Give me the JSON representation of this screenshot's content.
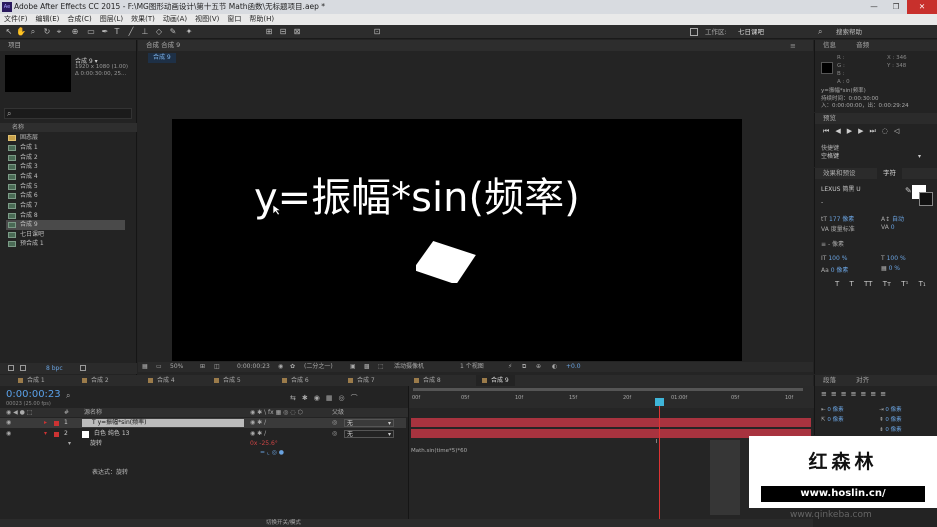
{
  "app": {
    "title": "Adobe After Effects CC 2015 - F:\\MG图形动画设计\\第十五节 Math函数\\无标题项目.aep *",
    "win_min": "—",
    "win_max": "❐",
    "win_close": "✕"
  },
  "menu": [
    "文件(F)",
    "编辑(E)",
    "合成(C)",
    "图层(L)",
    "效果(T)",
    "动画(A)",
    "视图(V)",
    "窗口",
    "帮助(H)"
  ],
  "toolbar": {
    "workspace_label": "工作区:",
    "workspace_value": "七日课吧",
    "search_help": "搜索帮助"
  },
  "project": {
    "panel_title": "项目",
    "comp_name": "合成 9 ▾",
    "comp_info_1": "1920 x 1080 (1.00)",
    "comp_info_2": "Δ 0:00:30:00, 25...",
    "search_icon": "⌕",
    "col_name": "名称",
    "items": [
      "固态层",
      "合成 1",
      "合成 2",
      "合成 3",
      "合成 4",
      "合成 5",
      "合成 6",
      "合成 7",
      "合成 8",
      "合成 9",
      "七日课吧",
      "预合成 1"
    ],
    "bpc": "8 bpc"
  },
  "composition_panel": {
    "tab_label": "合成 合成 9",
    "subtab": "合成 9"
  },
  "viewer": {
    "formula_text": "y=振幅*sin(频率)"
  },
  "viewer_status": {
    "zoom": "50%",
    "timecode": "0:00:00:23",
    "resolution": "(二分之一)",
    "camera": "活动摄像机",
    "views": "1 个视图",
    "exposure": "+0.0"
  },
  "info_panel": {
    "tab_info": "信息",
    "tab_audio": "音频",
    "r": "R :",
    "g": "G :",
    "b": "B :",
    "a": "A : 0",
    "x": "X : 346",
    "y": "Y : 348",
    "line1": "y=振幅*sin(频率)",
    "line2": "持续时间：0:00:30:00",
    "line3": "入：0:00:00:00，出：0:00:29:24"
  },
  "preview_panel": {
    "title": "预览",
    "shortcut_label": "快捷键",
    "shortcut_value": "空格键"
  },
  "effects_tab": "效果和预设",
  "character_panel": {
    "title": "字符",
    "font": "LEXUS 简黑 U",
    "style": "-",
    "size": "177 像素",
    "leading": "自动",
    "tracking_label": "度量标准",
    "tracking_value": "0",
    "stroke": "- 像素",
    "vscale": "100 %",
    "hscale": "100 %",
    "baseline": "0 像素",
    "tsume": "0 %",
    "caps": [
      "T",
      "T",
      "TT",
      "Tт",
      "T¹",
      "T₁"
    ]
  },
  "paragraph_panel": {
    "tab": "段落",
    "tab2": "对齐",
    "v1": "0 像素",
    "v2": "0 像素",
    "v3": "0 像素",
    "v4": "0 像素",
    "v5": "0 像素"
  },
  "timeline": {
    "tabs": [
      "合成 1",
      "合成 2",
      "合成 4",
      "合成 5",
      "合成 6",
      "合成 7",
      "合成 8",
      "合成 9"
    ],
    "timecode": "0:00:00:23",
    "frame_info": "00023 (25.00 fps)",
    "col_source": "源名称",
    "col_parent": "父级",
    "layers": [
      {
        "num": "1",
        "name": "y=振幅*sin(频率)",
        "parent": "无"
      },
      {
        "num": "2",
        "name": "白色 纯色 13",
        "parent": "无"
      }
    ],
    "rotation_label": "旋转",
    "rotation_value": "0x -25.6°",
    "expr_label": "表达式：旋转",
    "expression": "Math.sin(time*5)*60",
    "ruler": [
      "00f",
      "05f",
      "10f",
      "15f",
      "20f",
      "01:00f",
      "05f",
      "10f"
    ],
    "footer": "切换开关/模式"
  },
  "watermark": {
    "title": "红森林",
    "url": "www.hoslin.cn/",
    "url_bottom": "www.qinkeba.com"
  }
}
